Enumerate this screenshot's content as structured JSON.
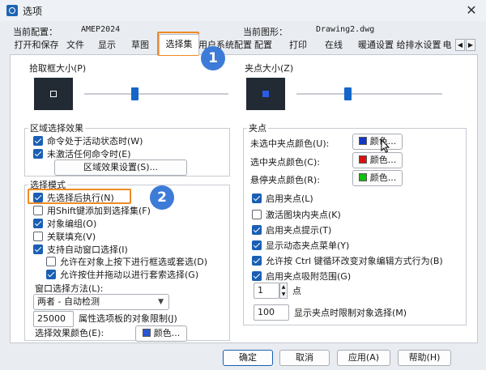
{
  "window": {
    "title": "选项",
    "close_glyph": "✕"
  },
  "info": {
    "config_label": "当前配置：",
    "config_value": "AMEP2024",
    "drawing_label": "当前图形：",
    "drawing_value": "Drawing2.dwg"
  },
  "tabs": [
    "打开和保存",
    "文件",
    "显示",
    "草图",
    "选择集",
    "用户系统配置",
    "配置",
    "打印",
    "在线",
    "暖通设置",
    "给排水设置",
    "电"
  ],
  "active_tab": "选择集",
  "tab_scroll": {
    "left": "◀",
    "right": "▶"
  },
  "pickbox": {
    "title": "拾取框大小(P)",
    "level": 0.35
  },
  "grip_size": {
    "title": "夹点大小(Z)",
    "level": 0.35
  },
  "area_selection": {
    "title": "区域选择效果",
    "items": [
      {
        "label": "命令处于活动状态时(W)",
        "checked": true
      },
      {
        "label": "未激活任何命令时(E)",
        "checked": true
      }
    ],
    "settings_button": "区域效果设置(S)..."
  },
  "selection_modes": {
    "title": "选择模式",
    "items": [
      {
        "label": "先选择后执行(N)",
        "checked": true
      },
      {
        "label": "用Shift键添加到选择集(F)",
        "checked": false
      },
      {
        "label": "对象编组(O)",
        "checked": true
      },
      {
        "label": "关联填充(V)",
        "checked": false
      },
      {
        "label": "支持自动窗口选择(I)",
        "checked": true
      },
      {
        "label": "允许在对象上按下进行框选或套选(D)",
        "checked": false
      },
      {
        "label": "允许按住并拖动以进行套索选择(G)",
        "checked": true
      }
    ],
    "window_method_label": "窗口选择方法(L):",
    "window_method_value": "两者 - 自动检测",
    "property_limit_value": "25000",
    "property_limit_label": "属性选项板的对象限制(J)",
    "effect_color_label": "选择效果颜色(E):",
    "effect_color_button": "颜色...",
    "effect_color": "#2a56d6"
  },
  "grips": {
    "title": "夹点",
    "unselected_label": "未选中夹点颜色(U):",
    "unselected_color": "#1338c8",
    "selected_label": "选中夹点颜色(C):",
    "selected_color": "#d81010",
    "hover_label": "悬停夹点颜色(R):",
    "hover_color": "#10c010",
    "color_button": "颜色...",
    "options": [
      {
        "label": "启用夹点(L)",
        "checked": true
      },
      {
        "label": "激活图块内夹点(K)",
        "checked": false
      },
      {
        "label": "启用夹点提示(T)",
        "checked": true
      },
      {
        "label": "显示动态夹点菜单(Y)",
        "checked": true
      },
      {
        "label": "允许按 Ctrl 键循环改变对象编辑方式行为(B)",
        "checked": true
      },
      {
        "label": "启用夹点吸附范围(G)",
        "checked": true
      }
    ],
    "snap_value": "1",
    "snap_unit": "点",
    "limit_value": "100",
    "limit_label": "显示夹点时限制对象选择(M)"
  },
  "annotations": {
    "badge1": "1",
    "badge2": "2"
  },
  "footer": {
    "ok": "确定",
    "cancel": "取消",
    "apply": "应用(A)",
    "help": "帮助(H)"
  }
}
